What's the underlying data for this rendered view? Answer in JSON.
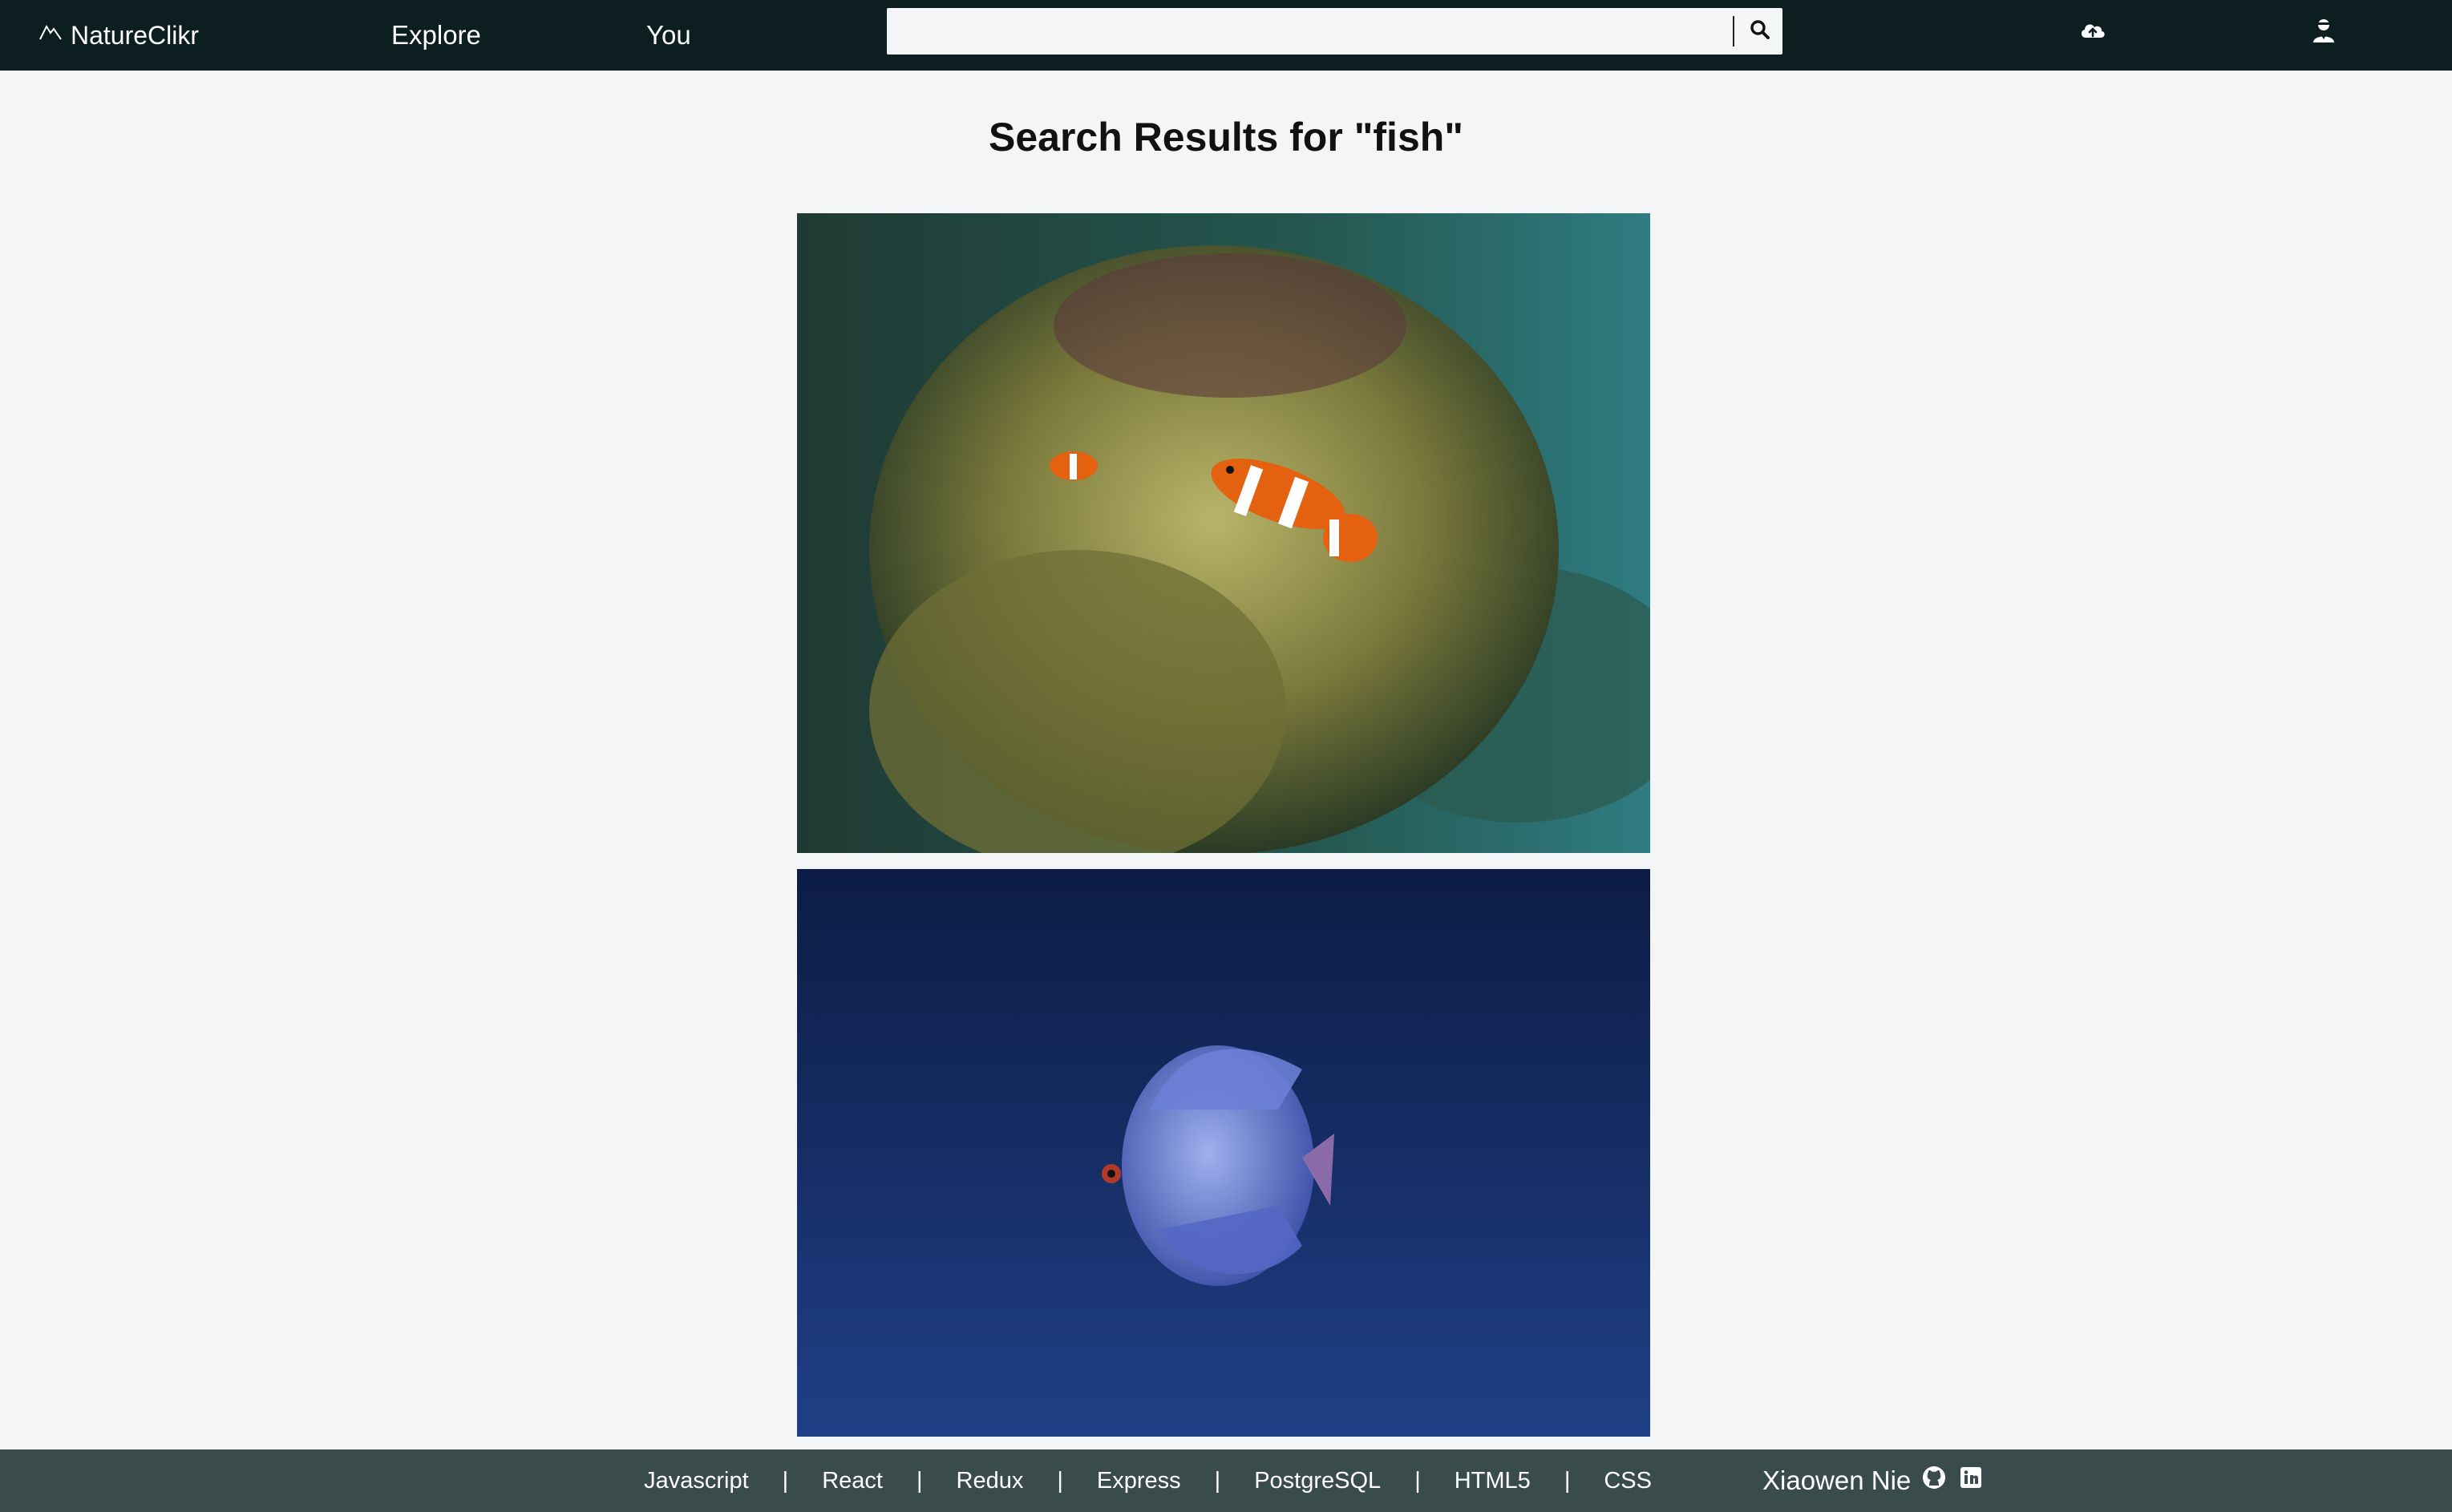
{
  "header": {
    "logo_text": "NatureClikr",
    "nav": [
      {
        "label": "Explore"
      },
      {
        "label": "You"
      }
    ],
    "search": {
      "value": "",
      "placeholder": ""
    },
    "icons": [
      "mountain-icon",
      "search-icon",
      "cloud-upload-icon",
      "user-icon"
    ]
  },
  "main": {
    "title": "Search Results for \"fish\"",
    "photos": [
      {
        "subject": "clownfish in sea anemone"
      },
      {
        "subject": "blue discus fish"
      }
    ]
  },
  "footer": {
    "tech": [
      "Javascript",
      "React",
      "Redux",
      "Express",
      "PostgreSQL",
      "HTML5",
      "CSS"
    ],
    "separator": "|",
    "author": "Xiaowen Nie",
    "icons": [
      "github-icon",
      "linkedin-icon"
    ]
  },
  "colors": {
    "header_bg": "#0c1e1f",
    "page_bg": "#f3f5f7",
    "footer_bg": "#3a4b4c"
  }
}
